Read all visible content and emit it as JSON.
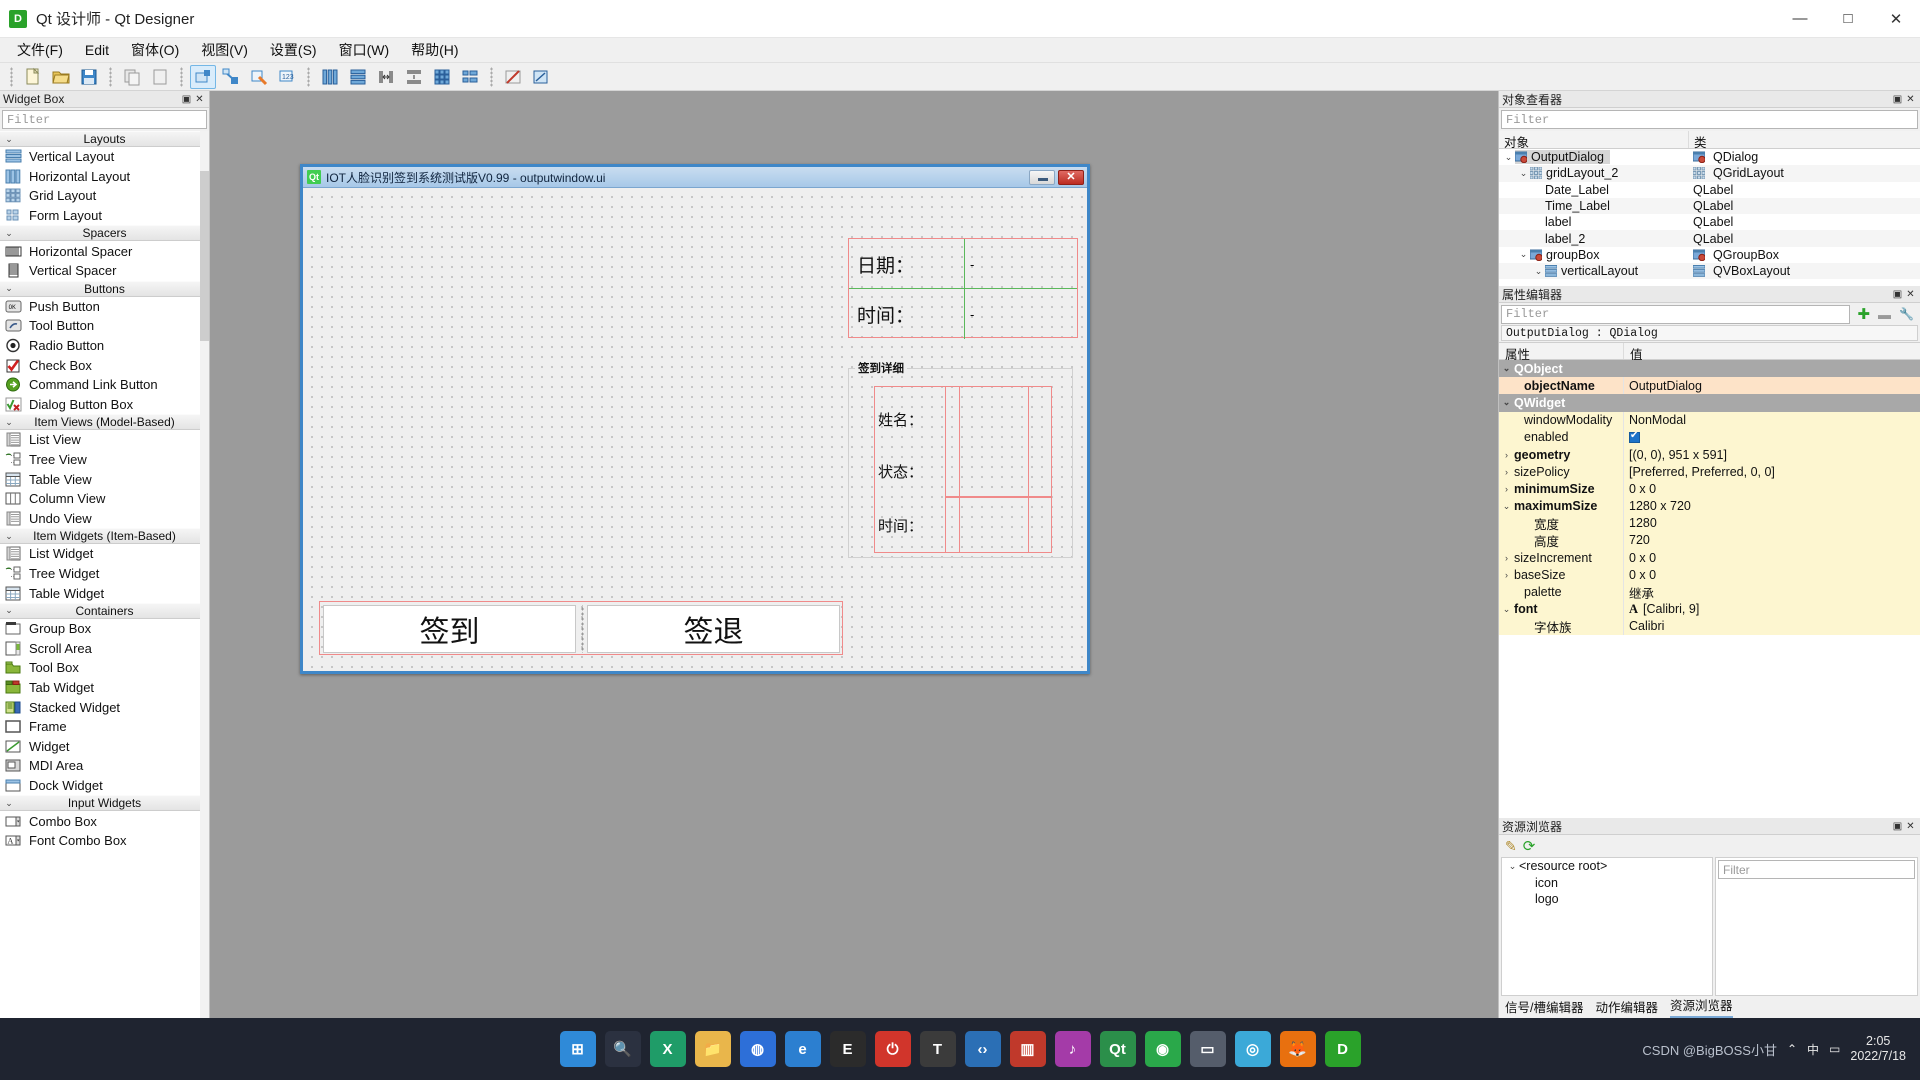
{
  "window": {
    "app_icon_letter": "D",
    "title": "Qt 设计师 - Qt Designer",
    "minimize": "—",
    "maximize": "□",
    "close": "✕"
  },
  "menubar": {
    "items": [
      {
        "label": "文件(F)"
      },
      {
        "label": "Edit"
      },
      {
        "label": "窗体(O)"
      },
      {
        "label": "视图(V)"
      },
      {
        "label": "设置(S)"
      },
      {
        "label": "窗口(W)"
      },
      {
        "label": "帮助(H)"
      }
    ]
  },
  "toolbar": {
    "groups": [
      {
        "buttons": [
          {
            "name": "new-form-icon"
          },
          {
            "name": "open-form-icon"
          },
          {
            "name": "save-form-icon"
          }
        ]
      },
      {
        "buttons": [
          {
            "name": "cut-icon"
          },
          {
            "name": "copy-icon"
          }
        ]
      },
      {
        "buttons": [
          {
            "name": "edit-widgets-icon",
            "active": true
          },
          {
            "name": "edit-signals-slots-icon"
          },
          {
            "name": "edit-buddies-icon"
          },
          {
            "name": "edit-tab-order-icon"
          }
        ]
      },
      {
        "buttons": [
          {
            "name": "layout-horizontally-icon"
          },
          {
            "name": "layout-vertically-icon"
          },
          {
            "name": "layout-splitter-horizontal-icon"
          },
          {
            "name": "layout-splitter-vertical-icon"
          },
          {
            "name": "layout-grid-icon"
          },
          {
            "name": "layout-form-icon"
          }
        ]
      },
      {
        "buttons": [
          {
            "name": "break-layout-icon"
          },
          {
            "name": "adjust-size-icon"
          }
        ]
      }
    ]
  },
  "widget_box": {
    "title": "Widget Box",
    "float_btn": "▣",
    "close_btn": "✕",
    "filter_placeholder": "Filter",
    "groups": [
      {
        "name": "Layouts",
        "items": [
          {
            "label": "Vertical Layout",
            "icon": "vertical-layout-icon"
          },
          {
            "label": "Horizontal Layout",
            "icon": "horizontal-layout-icon"
          },
          {
            "label": "Grid Layout",
            "icon": "grid-layout-icon"
          },
          {
            "label": "Form Layout",
            "icon": "form-layout-icon"
          }
        ]
      },
      {
        "name": "Spacers",
        "items": [
          {
            "label": "Horizontal Spacer",
            "icon": "horizontal-spacer-icon"
          },
          {
            "label": "Vertical Spacer",
            "icon": "vertical-spacer-icon"
          }
        ]
      },
      {
        "name": "Buttons",
        "items": [
          {
            "label": "Push Button",
            "icon": "push-button-icon"
          },
          {
            "label": "Tool Button",
            "icon": "tool-button-icon"
          },
          {
            "label": "Radio Button",
            "icon": "radio-button-icon"
          },
          {
            "label": "Check Box",
            "icon": "check-box-icon"
          },
          {
            "label": "Command Link Button",
            "icon": "command-link-button-icon"
          },
          {
            "label": "Dialog Button Box",
            "icon": "dialog-button-box-icon"
          }
        ]
      },
      {
        "name": "Item Views (Model-Based)",
        "items": [
          {
            "label": "List View",
            "icon": "list-view-icon"
          },
          {
            "label": "Tree View",
            "icon": "tree-view-icon"
          },
          {
            "label": "Table View",
            "icon": "table-view-icon"
          },
          {
            "label": "Column View",
            "icon": "column-view-icon"
          },
          {
            "label": "Undo View",
            "icon": "undo-view-icon"
          }
        ]
      },
      {
        "name": "Item Widgets (Item-Based)",
        "items": [
          {
            "label": "List Widget",
            "icon": "list-widget-icon"
          },
          {
            "label": "Tree Widget",
            "icon": "tree-widget-icon"
          },
          {
            "label": "Table Widget",
            "icon": "table-widget-icon"
          }
        ]
      },
      {
        "name": "Containers",
        "items": [
          {
            "label": "Group Box",
            "icon": "group-box-icon"
          },
          {
            "label": "Scroll Area",
            "icon": "scroll-area-icon"
          },
          {
            "label": "Tool Box",
            "icon": "tool-box-icon"
          },
          {
            "label": "Tab Widget",
            "icon": "tab-widget-icon"
          },
          {
            "label": "Stacked Widget",
            "icon": "stacked-widget-icon"
          },
          {
            "label": "Frame",
            "icon": "frame-icon"
          },
          {
            "label": "Widget",
            "icon": "widget-icon"
          },
          {
            "label": "MDI Area",
            "icon": "mdi-area-icon"
          },
          {
            "label": "Dock Widget",
            "icon": "dock-widget-icon"
          }
        ]
      },
      {
        "name": "Input Widgets",
        "items": [
          {
            "label": "Combo Box",
            "icon": "combo-box-icon"
          },
          {
            "label": "Font Combo Box",
            "icon": "font-combo-box-icon"
          }
        ]
      }
    ]
  },
  "form": {
    "qt_icon_letter": "Qt",
    "title": "IOT人脸识别签到系统测试版V0.99 - outputwindow.ui",
    "minimize": "",
    "close": "✕",
    "date_label": "日期：",
    "date_value": "-",
    "time_label": "时间：",
    "time_value": "-",
    "groupbox_title": "签到详细",
    "name_label": "姓名：",
    "status_label": "状态：",
    "detail_time_label": "时间：",
    "signin_button": "签到",
    "signout_button": "签退"
  },
  "object_inspector": {
    "title": "对象查看器",
    "float_btn": "▣",
    "close_btn": "✕",
    "filter_placeholder": "Filter",
    "col_object": "对象",
    "col_class": "类",
    "rows": [
      {
        "name": "OutputDialog",
        "class": "QDialog",
        "indent": 0,
        "twisty": "⌄",
        "icon": "dialog-icon",
        "selected": true
      },
      {
        "name": "gridLayout_2",
        "class": "QGridLayout",
        "indent": 1,
        "twisty": "⌄",
        "icon": "grid-layout-icon",
        "selected": false
      },
      {
        "name": "Date_Label",
        "class": "QLabel",
        "indent": 2,
        "twisty": "",
        "icon": "",
        "selected": false
      },
      {
        "name": "Time_Label",
        "class": "QLabel",
        "indent": 2,
        "twisty": "",
        "icon": "",
        "selected": false
      },
      {
        "name": "label",
        "class": "QLabel",
        "indent": 2,
        "twisty": "",
        "icon": "",
        "selected": false
      },
      {
        "name": "label_2",
        "class": "QLabel",
        "indent": 2,
        "twisty": "",
        "icon": "",
        "selected": false
      },
      {
        "name": "groupBox",
        "class": "QGroupBox",
        "indent": 1,
        "twisty": "⌄",
        "icon": "groupbox-icon",
        "selected": false
      },
      {
        "name": "verticalLayout",
        "class": "QVBoxLayout",
        "indent": 2,
        "twisty": "⌄",
        "icon": "vertical-layout-icon",
        "selected": false
      }
    ]
  },
  "property_editor": {
    "title": "属性编辑器",
    "float_btn": "▣",
    "close_btn": "✕",
    "filter_placeholder": "Filter",
    "add_btn": "✚",
    "remove_btn": "▬",
    "config_btn": "🔧",
    "object_line": "OutputDialog : QDialog",
    "col_property": "属性",
    "col_value": "值",
    "rows": [
      {
        "name": "QObject",
        "value": "",
        "style": "group",
        "twisty": "⌄",
        "indent": 0
      },
      {
        "name": "objectName",
        "value": "OutputDialog",
        "style": "highlight",
        "twisty": "",
        "indent": 1
      },
      {
        "name": "QWidget",
        "value": "",
        "style": "group",
        "twisty": "⌄",
        "indent": 0
      },
      {
        "name": "windowModality",
        "value": "NonModal",
        "style": "yellow",
        "twisty": "",
        "indent": 1
      },
      {
        "name": "enabled",
        "value": "",
        "style": "yellow",
        "twisty": "",
        "indent": 1,
        "checkbox": true
      },
      {
        "name": "geometry",
        "value": "[(0, 0), 951 x 591]",
        "style": "yellow",
        "twisty": "›",
        "indent": 0,
        "bold": true
      },
      {
        "name": "sizePolicy",
        "value": "[Preferred, Preferred, 0, 0]",
        "style": "yellow",
        "twisty": "›",
        "indent": 0
      },
      {
        "name": "minimumSize",
        "value": "0 x 0",
        "style": "yellow",
        "twisty": "›",
        "indent": 0,
        "bold": true
      },
      {
        "name": "maximumSize",
        "value": "1280 x 720",
        "style": "yellow",
        "twisty": "⌄",
        "indent": 0,
        "bold": true
      },
      {
        "name": "宽度",
        "value": "1280",
        "style": "yellow",
        "twisty": "",
        "indent": 2
      },
      {
        "name": "高度",
        "value": "720",
        "style": "yellow",
        "twisty": "",
        "indent": 2
      },
      {
        "name": "sizeIncrement",
        "value": "0 x 0",
        "style": "yellow",
        "twisty": "›",
        "indent": 0
      },
      {
        "name": "baseSize",
        "value": "0 x 0",
        "style": "yellow",
        "twisty": "›",
        "indent": 0
      },
      {
        "name": "palette",
        "value": "继承",
        "style": "yellow",
        "twisty": "",
        "indent": 1
      },
      {
        "name": "font",
        "value": "[Calibri, 9]",
        "style": "yellow",
        "twisty": "⌄",
        "indent": 0,
        "bold": true,
        "font_glyph": "A"
      },
      {
        "name": "字体族",
        "value": "Calibri",
        "style": "yellow",
        "twisty": "",
        "indent": 2
      }
    ]
  },
  "resource_browser": {
    "title": "资源浏览器",
    "float_btn": "▣",
    "close_btn": "✕",
    "edit_btn": "✎",
    "reload_btn": "⟳",
    "filter_placeholder": "Filter",
    "rows": [
      {
        "label": "<resource root>",
        "indent": 0,
        "twisty": "⌄"
      },
      {
        "label": "icon",
        "indent": 1,
        "twisty": ""
      },
      {
        "label": "logo",
        "indent": 1,
        "twisty": ""
      }
    ],
    "tabs": [
      {
        "label": "信号/槽编辑器",
        "active": false
      },
      {
        "label": "动作编辑器",
        "active": false
      },
      {
        "label": "资源浏览器",
        "active": true
      }
    ]
  },
  "taskbar": {
    "icons": [
      {
        "name": "start-windows-icon",
        "glyph": "⊞",
        "color": "#2f8ad8"
      },
      {
        "name": "search-icon",
        "glyph": "🔍",
        "color": "#2b3140"
      },
      {
        "name": "xmind-icon",
        "glyph": "X",
        "color": "#1f9c68"
      },
      {
        "name": "file-explorer-icon",
        "glyph": "📁",
        "color": "#e9b64b"
      },
      {
        "name": "browser-icon",
        "glyph": "◍",
        "color": "#2d6fd8"
      },
      {
        "name": "edge-icon",
        "glyph": "e",
        "color": "#2c7fd0"
      },
      {
        "name": "epic-games-icon",
        "glyph": "E",
        "color": "#2b2b2b"
      },
      {
        "name": "power-tool-icon",
        "glyph": "⏻",
        "color": "#d1352b"
      },
      {
        "name": "typora-icon",
        "glyph": "T",
        "color": "#3b3b3b"
      },
      {
        "name": "vscode-icon",
        "glyph": "‹›",
        "color": "#2b6fb5"
      },
      {
        "name": "chart-app-icon",
        "glyph": "▥",
        "color": "#c0392b"
      },
      {
        "name": "music-app-icon",
        "glyph": "♪",
        "color": "#a43ba8"
      },
      {
        "name": "qt-designer-icon",
        "glyph": "Qt",
        "color": "#2b8f4a"
      },
      {
        "name": "terminal-green-icon",
        "glyph": "◉",
        "color": "#2aa84a"
      },
      {
        "name": "console-icon",
        "glyph": "▭",
        "color": "#555d6b"
      },
      {
        "name": "network-icon",
        "glyph": "◎",
        "color": "#3ba9d8"
      },
      {
        "name": "firefox-icon",
        "glyph": "🦊",
        "color": "#e8700f"
      },
      {
        "name": "designer-active-icon",
        "glyph": "D",
        "color": "#2aa22a"
      }
    ],
    "tray": {
      "chevron": "⌃",
      "ime": "中",
      "battery_icon": "▭",
      "clock_time": "2:05",
      "clock_date": "2022/7/18",
      "watermark": "CSDN @BigBOSS小甘"
    }
  }
}
